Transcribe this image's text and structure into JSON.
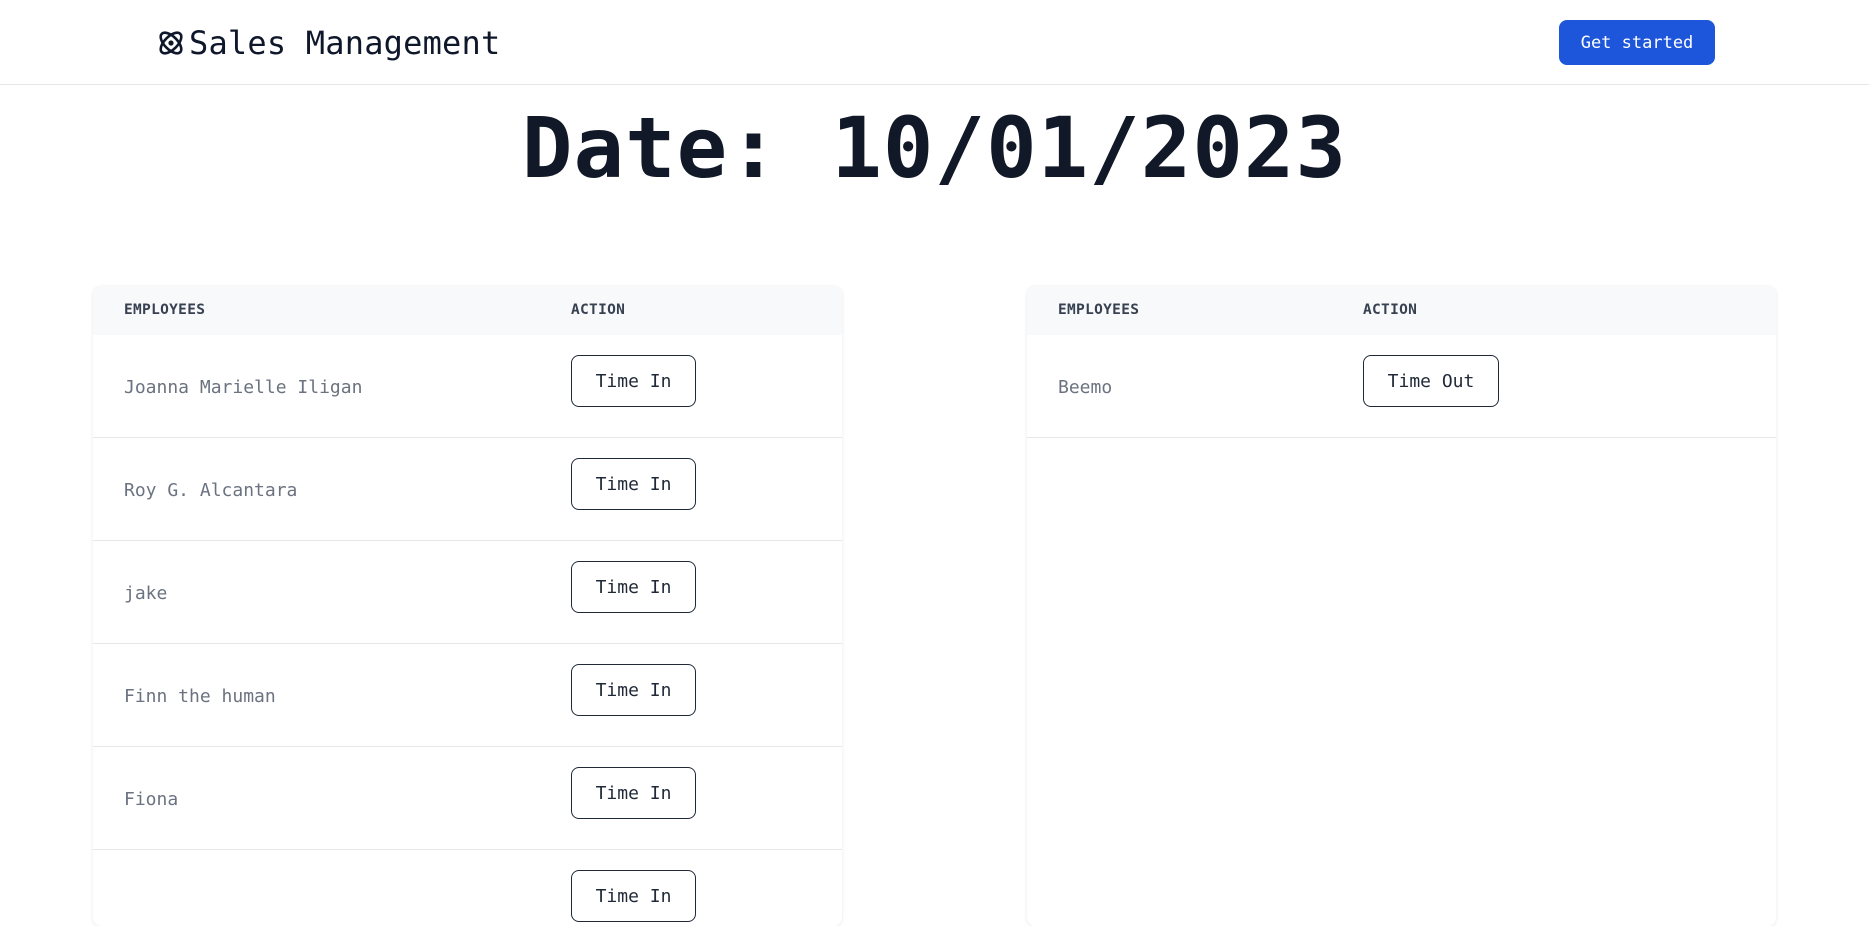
{
  "header": {
    "brand_icon": "atom-icon",
    "title": "Sales Management",
    "cta_label": "Get started",
    "accent_color": "#1d56db"
  },
  "date_title": "Date: 10/01/2023",
  "time_in_table": {
    "columns": [
      "EMPLOYEES",
      "ACTION"
    ],
    "rows": [
      {
        "name": "Joanna Marielle Iligan",
        "action": "Time In"
      },
      {
        "name": "Roy G. Alcantara",
        "action": "Time In"
      },
      {
        "name": "jake",
        "action": "Time In"
      },
      {
        "name": "Finn the human",
        "action": "Time In"
      },
      {
        "name": "Fiona",
        "action": "Time In"
      },
      {
        "name": "",
        "action": "Time In"
      }
    ]
  },
  "time_out_table": {
    "columns": [
      "EMPLOYEES",
      "ACTION"
    ],
    "rows": [
      {
        "name": "Beemo",
        "action": "Time Out"
      }
    ]
  }
}
